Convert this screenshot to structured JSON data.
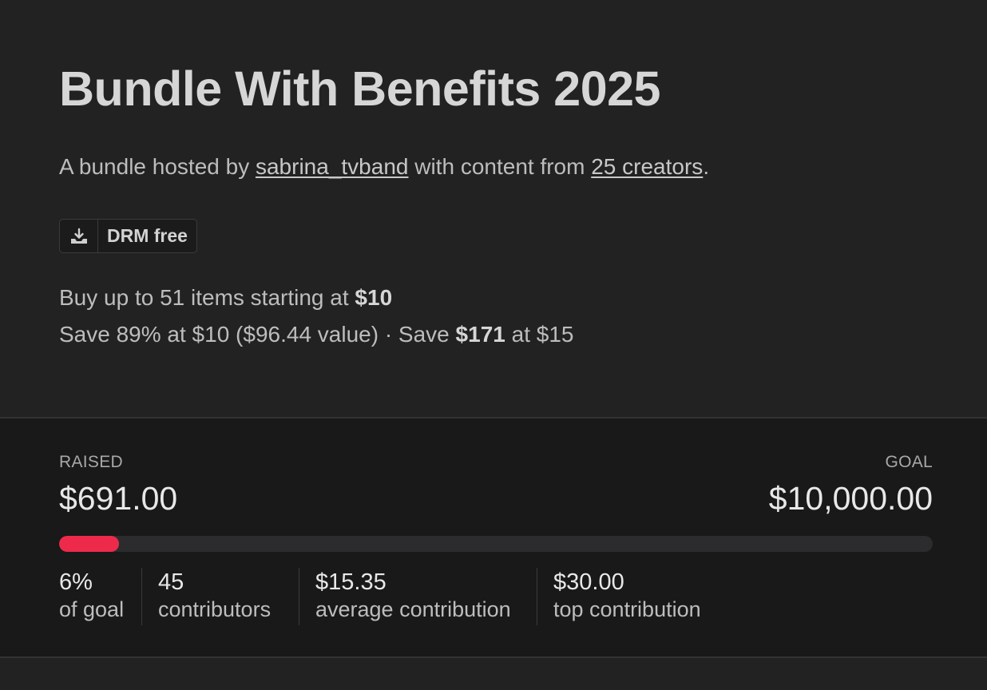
{
  "bundle": {
    "title": "Bundle With Benefits 2025",
    "subtitle_prefix": "A bundle hosted by ",
    "host": "sabrina_tvband",
    "subtitle_middle": " with content from ",
    "creators_link": "25 creators",
    "subtitle_suffix": "."
  },
  "badge": {
    "icon": "download-tray-icon",
    "label": "DRM free"
  },
  "pricing": {
    "line1_prefix": "Buy up to 51 items starting at ",
    "line1_price": "$10",
    "line2_prefix": "Save 89% at $10 ($96.44 value) · Save ",
    "line2_amount": "$171",
    "line2_suffix": " at $15"
  },
  "funding": {
    "raised_label": "RAISED",
    "raised_amount": "$691.00",
    "goal_label": "GOAL",
    "goal_amount": "$10,000.00",
    "progress_fraction": 0.069,
    "accent_color": "#ee2a4b",
    "metrics": [
      {
        "value": "6%",
        "caption": "of goal"
      },
      {
        "value": "45",
        "caption": "contributors"
      },
      {
        "value": "$15.35",
        "caption": "average contribution"
      },
      {
        "value": "$30.00",
        "caption": "top contribution"
      }
    ]
  }
}
